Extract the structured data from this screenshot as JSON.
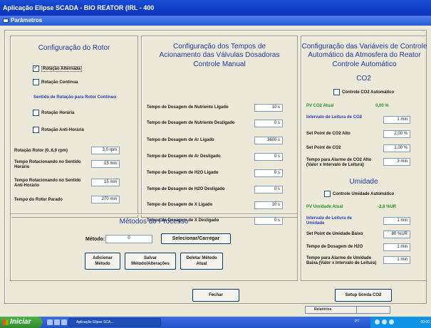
{
  "window": {
    "title": "Aplicação Elipse SCADA - BIO REATOR (IRL - 400",
    "params_title": "Parâmetros"
  },
  "rotor": {
    "title": "Configuração do Rotor",
    "alternada_label": "Rotação Alternada",
    "alternada_checked": true,
    "continua_label": "Rotação Contínua",
    "continua_checked": false,
    "section_label": "Sentido de Rotação para Rotor Contínuo",
    "horaria_label": "Rotação Horária",
    "antihoraria_label": "Rotação Anti-Horária",
    "rotacao_label": "Rotação Rotor (0..6,9 rpm)",
    "rotacao_value": "3,0 rpm",
    "tempo_horario_label": "Tempo Rotacionando no Sentido Horário",
    "tempo_horario_value": "15 min",
    "tempo_antihorario_label": "Tempo Rotacionando no Sentido Anti-Horário",
    "tempo_antihorario_value": "15 min",
    "tempo_parado_label": "Tempo do Rotor Parado",
    "tempo_parado_value": "270 min"
  },
  "valvulas": {
    "title1": "Configuração dos Tempos de",
    "title2": "Acionamento das Válvulas Dosadoras",
    "title3": "Controle Manual",
    "rows": [
      {
        "label": "Tempo de Dosagem de Nutriente Ligado",
        "value": "10 s"
      },
      {
        "label": "Tempo de Dosagem de Nutriente Desligado",
        "value": "0 s"
      },
      {
        "label": "Tempo de Dosagem de Ar Ligado",
        "value": "3600 s"
      },
      {
        "label": "Tempo de Dosagem de Ar Desligado",
        "value": "0 s"
      },
      {
        "label": "Tempo de Dosagem de H2O Ligado",
        "value": "0 s"
      },
      {
        "label": "Tempo de Dosagem de H2O Desligado",
        "value": "0 s"
      },
      {
        "label": "Tempo de Dosagem de X Ligado",
        "value": "10 s"
      },
      {
        "label": "Tempo de Dosagem de X Desligado",
        "value": "0 s"
      }
    ]
  },
  "atmosfera": {
    "title1": "Configuração das Variáveis de Controle",
    "title2": "Automático da Atmosfera do Reator",
    "title3": "Controle Automático",
    "co2": {
      "heading": "CO2",
      "auto_label": "Controle CO2 Automático",
      "pv_label": "PV CO2 Atual",
      "pv_value": "0,00 %",
      "intervalo_label": "Intervalo de Leitura de CO2",
      "intervalo_value": "1 min",
      "sp_alto_label": "Set Point de CO2 Alto",
      "sp_alto_value": "2,00 %",
      "sp_label": "Set Point de CO2",
      "sp_value": "1,00 %",
      "alarme_label": "Tempo para Alarme de CO2 Alto (Valor x Intervalo de Leitura)",
      "alarme_value": "3 min"
    },
    "umidade": {
      "heading": "Umidade",
      "auto_label": "Controle Umidade Automático",
      "pv_label": "PV Umidade Atual",
      "pv_value": "-2,8 %UR",
      "intervalo_label": "Intervalo de Leitura de Umidade",
      "intervalo_value": "1 min",
      "sp_baixo_label": "Set Point de Umidade Baixo",
      "sp_baixo_value": "80 %UR",
      "dosagem_label": "Tempo de Dosagem de H2O",
      "dosagem_value": "1 min",
      "alarme_label": "Tempo para Alarme de Umidade Baixa (Valor x Intervalo de Leitura)",
      "alarme_value": "1 min"
    }
  },
  "metodos": {
    "title": "Métodos de Processo",
    "metodo_label": "Método:",
    "metodo_value": "0",
    "selecionar_label": "Selecionar/Carregar",
    "adicionar_label": "Adicionar Método",
    "salvar_label": "Salvar Método/Alterações",
    "deletar_label": "Deletar Método Atual"
  },
  "footer": {
    "fechar_label": "Fechar",
    "setup_label": "Setup Sonda CO2",
    "relatorios_label": "Relatórios"
  },
  "taskbar": {
    "start_label": "Iniciar",
    "task_label": "Aplicação Elipse SCA...",
    "lang": "PT",
    "clock": "00:00"
  }
}
